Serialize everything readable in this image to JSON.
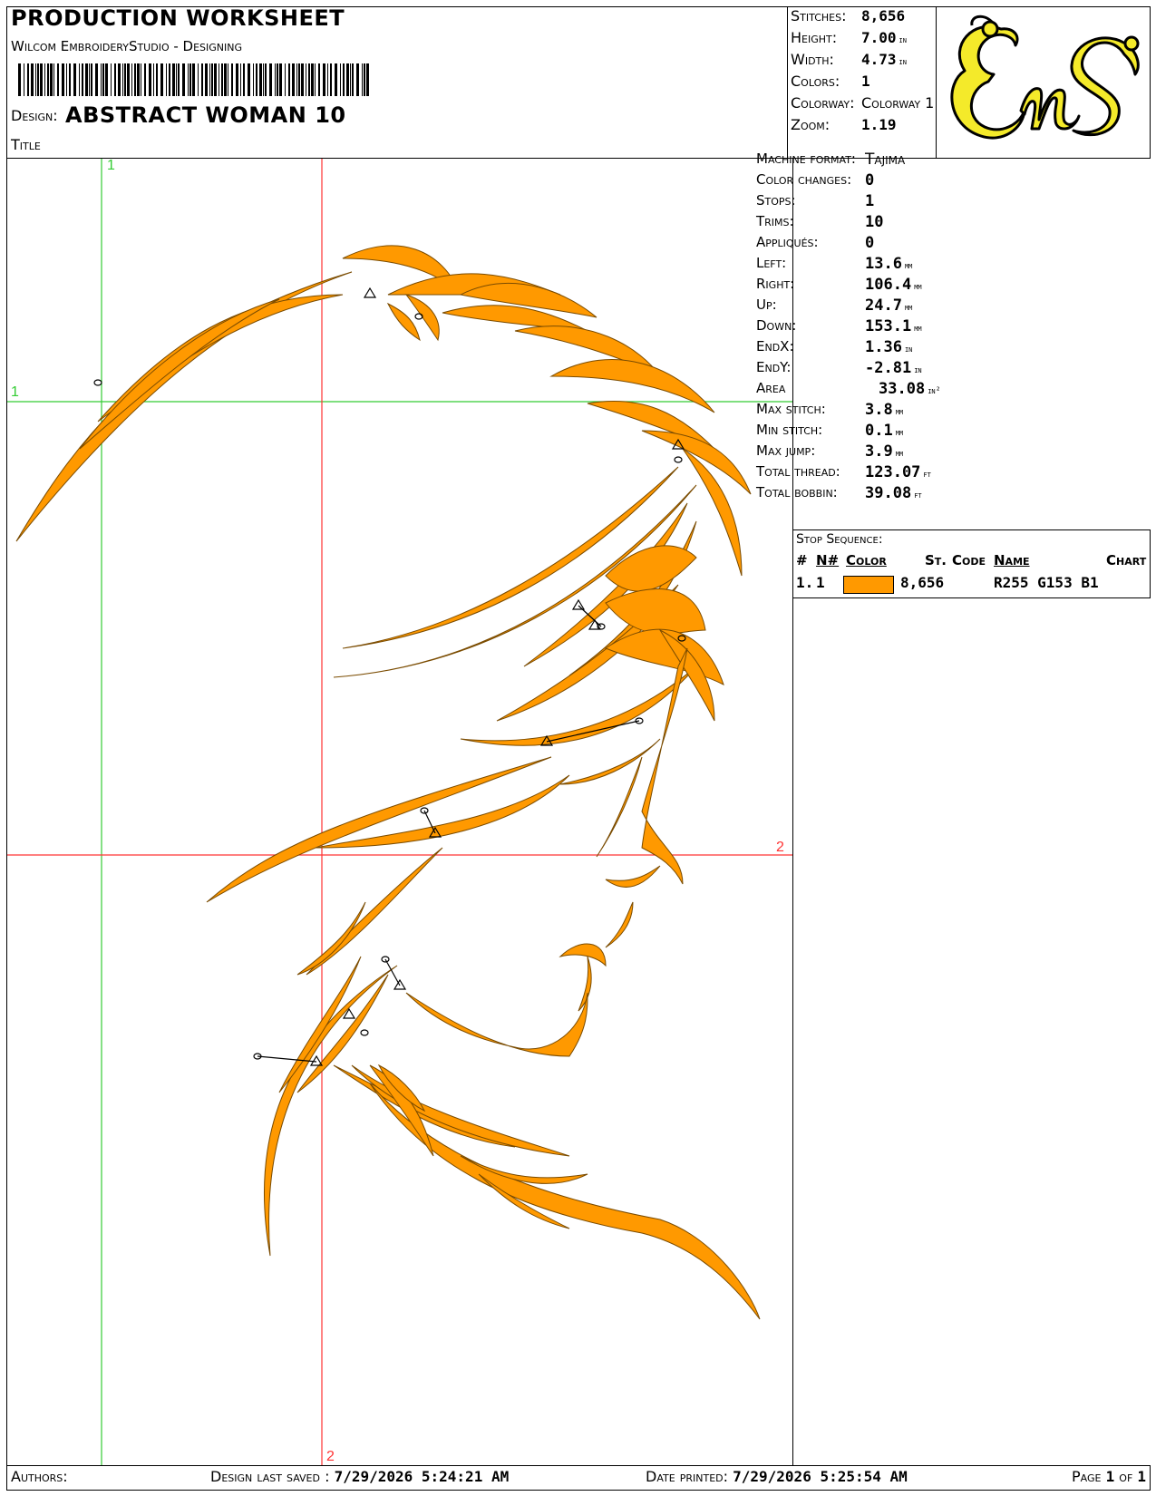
{
  "header": {
    "title": "PRODUCTION WORKSHEET",
    "subtitle": "Wilcom EmbroideryStudio - Designing",
    "design_label": "Design:",
    "design_value": "ABSTRACT WOMAN  10",
    "title_label": "Title"
  },
  "stats": {
    "stitches": {
      "label": "Stitches:",
      "value": "8,656"
    },
    "height": {
      "label": "Height:",
      "value": "7.00",
      "unit": "in"
    },
    "width": {
      "label": "Width:",
      "value": "4.73",
      "unit": "in"
    },
    "colors": {
      "label": "Colors:",
      "value": "1"
    },
    "colorway": {
      "label": "Colorway:",
      "value": "Colorway 1"
    },
    "zoom": {
      "label": "Zoom:",
      "value": "1.19"
    }
  },
  "logo": {
    "text": "EnS",
    "fill_color": "#f4ea2a",
    "stroke_color": "#000000"
  },
  "specs": {
    "machine_format": {
      "label": "Machine format:",
      "value": "Tajima"
    },
    "color_changes": {
      "label": "Color changes:",
      "value": "0"
    },
    "stops": {
      "label": "Stops:",
      "value": "1"
    },
    "trims": {
      "label": "Trims:",
      "value": "10"
    },
    "appliques": {
      "label": "Appliqués:",
      "value": "0"
    },
    "left": {
      "label": "Left:",
      "value": "13.6",
      "unit": "mm"
    },
    "right": {
      "label": "Right:",
      "value": "106.4",
      "unit": "mm"
    },
    "up": {
      "label": "Up:",
      "value": "24.7",
      "unit": "mm"
    },
    "down": {
      "label": "Down:",
      "value": "153.1",
      "unit": "mm"
    },
    "endx": {
      "label": "EndX:",
      "value": "1.36",
      "unit": "in"
    },
    "endy": {
      "label": "EndY:",
      "value": "-2.81",
      "unit": "in"
    },
    "area": {
      "label": "Area",
      "value": "33.08",
      "unit": "in²"
    },
    "max_stitch": {
      "label": "Max stitch:",
      "value": "3.8",
      "unit": "mm"
    },
    "min_stitch": {
      "label": "Min stitch:",
      "value": "0.1",
      "unit": "mm"
    },
    "max_jump": {
      "label": "Max jump:",
      "value": "3.9",
      "unit": "mm"
    },
    "total_thread": {
      "label": "Total thread:",
      "value": "123.07",
      "unit": "ft"
    },
    "total_bobbin": {
      "label": "Total bobbin:",
      "value": "39.08",
      "unit": "ft"
    }
  },
  "stop_sequence": {
    "title": "Stop Sequence:",
    "headers": {
      "num": "#",
      "nnum": "N#",
      "color": "Color",
      "st": "St.",
      "code": "Code",
      "name": "Name",
      "chart": "Chart"
    },
    "rows": [
      {
        "num": "1.",
        "nnum": "1",
        "swatch": "#ff9900",
        "stitches": "8,656",
        "name": "R255 G153 B1"
      }
    ]
  },
  "canvas": {
    "guide1_label_top": "1",
    "guide1_label_left": "1",
    "guide2_label_right": "2",
    "guide2_label_bottom": "2",
    "guide1_color": "#33cc33",
    "guide2_color": "#ff3333",
    "thread_color": "#ff9900"
  },
  "footer": {
    "authors_label": "Authors:",
    "saved_label": "Design last saved :",
    "saved_value": "7/29/2026 5:24:21 AM",
    "printed_label": "Date printed:",
    "printed_value": "7/29/2026 5:25:54 AM",
    "page_label": "Page",
    "page_num": "1",
    "page_of": "of",
    "page_total": "1"
  }
}
